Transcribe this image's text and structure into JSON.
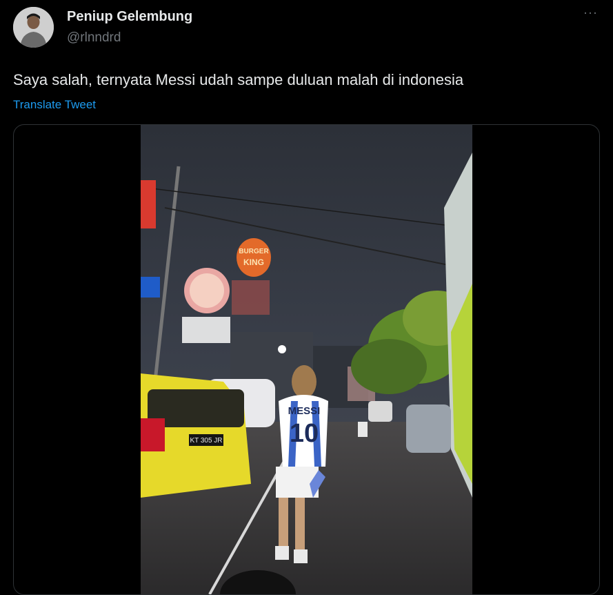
{
  "tweet": {
    "author_name": "Peniup Gelembung",
    "author_handle": "@rlnndrd",
    "more_label": "···",
    "text": "Saya salah, ternyata Messi udah sampe duluan malah di indonesia",
    "translate_label": "Translate Tweet"
  },
  "video_scene": {
    "sign_top": "BURGER",
    "sign_bottom": "KING",
    "jersey_name": "MESSI",
    "jersey_number": "10",
    "plate": "KT 305 JR"
  },
  "colors": {
    "background": "#000000",
    "text_primary": "#e7e9ea",
    "text_secondary": "#71767b",
    "link": "#1d9bf0",
    "border": "#2f3336"
  },
  "icons": [
    "more-icon",
    "avatar"
  ]
}
